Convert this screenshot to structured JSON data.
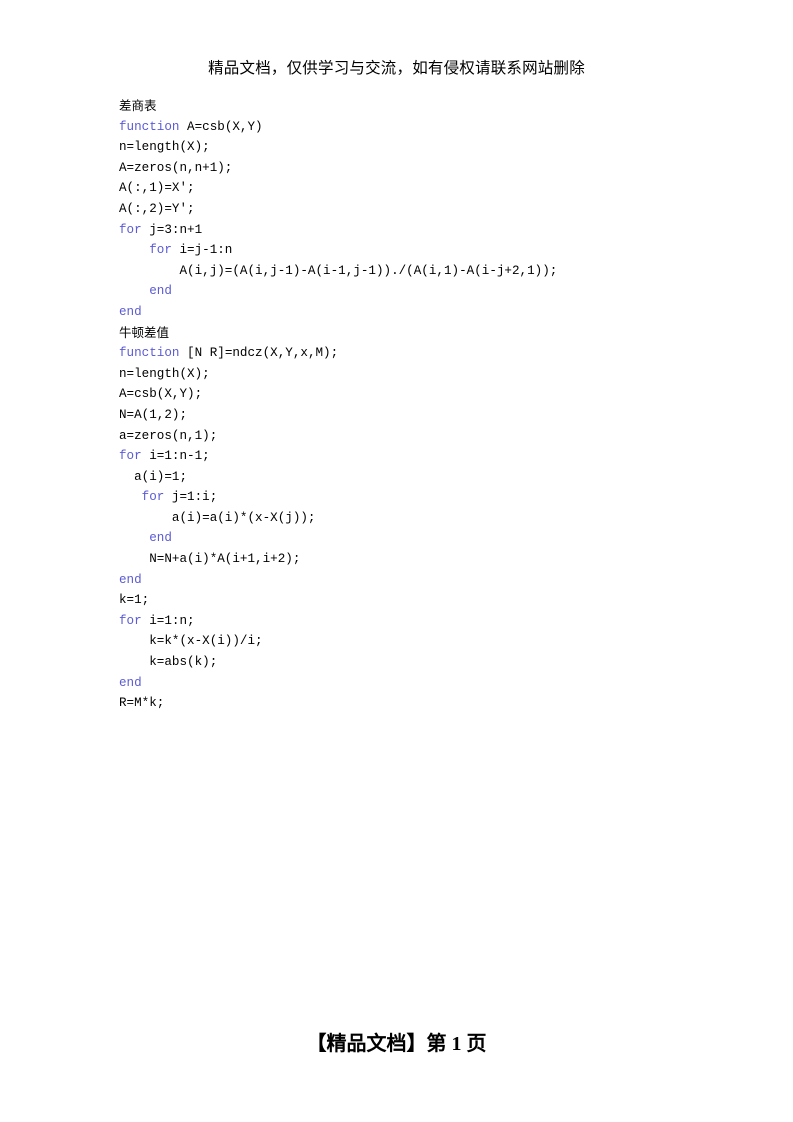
{
  "header": {
    "banner_text": "精品文档，仅供学习与交流，如有侵权请联系网站删除"
  },
  "footer": {
    "text": "【精品文档】第 1 页"
  },
  "colors": {
    "keyword": "#5b5bd6",
    "text": "#000000",
    "background": "#ffffff"
  },
  "sections": [
    {
      "title": "差商表",
      "lines": [
        {
          "keyword": "function",
          "rest": " A=csb(X,Y)"
        },
        {
          "keyword": "",
          "rest": "n=length(X);"
        },
        {
          "keyword": "",
          "rest": "A=zeros(n,n+1);"
        },
        {
          "keyword": "",
          "rest": "A(:,1)=X';"
        },
        {
          "keyword": "",
          "rest": "A(:,2)=Y';"
        },
        {
          "keyword": "for",
          "rest": " j=3:n+1"
        },
        {
          "keyword": "    for",
          "rest": " i=j-1:n"
        },
        {
          "keyword": "",
          "rest": "        A(i,j)=(A(i,j-1)-A(i-1,j-1))./(A(i,1)-A(i-j+2,1));"
        },
        {
          "keyword": "    end",
          "rest": ""
        },
        {
          "keyword": "end",
          "rest": ""
        }
      ]
    },
    {
      "title": "牛顿差值",
      "lines": [
        {
          "keyword": "function",
          "rest": " [N R]=ndcz(X,Y,x,M);"
        },
        {
          "keyword": "",
          "rest": "n=length(X);"
        },
        {
          "keyword": "",
          "rest": "A=csb(X,Y);"
        },
        {
          "keyword": "",
          "rest": "N=A(1,2);"
        },
        {
          "keyword": "",
          "rest": "a=zeros(n,1);"
        },
        {
          "keyword": "for",
          "rest": " i=1:n-1;"
        },
        {
          "keyword": "",
          "rest": "  a(i)=1;"
        },
        {
          "keyword": "   for",
          "rest": " j=1:i;"
        },
        {
          "keyword": "",
          "rest": "       a(i)=a(i)*(x-X(j));"
        },
        {
          "keyword": "    end",
          "rest": ""
        },
        {
          "keyword": "",
          "rest": "    N=N+a(i)*A(i+1,i+2);"
        },
        {
          "keyword": "end",
          "rest": ""
        },
        {
          "keyword": "",
          "rest": "k=1;"
        },
        {
          "keyword": "for",
          "rest": " i=1:n;"
        },
        {
          "keyword": "",
          "rest": "    k=k*(x-X(i))/i;"
        },
        {
          "keyword": "",
          "rest": "    k=abs(k);"
        },
        {
          "keyword": "end",
          "rest": ""
        },
        {
          "keyword": "",
          "rest": "R=M*k;"
        }
      ]
    }
  ]
}
